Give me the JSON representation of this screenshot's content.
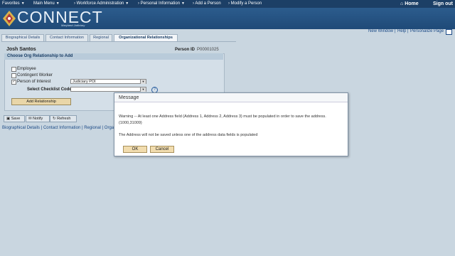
{
  "topnav": {
    "favorites": "Favorites",
    "main_menu": "Main Menu",
    "workforce": "Workforce Administration",
    "personal_info": "Personal Information",
    "add_person": "Add a Person",
    "modify_person": "Modify a Person",
    "home": "Home",
    "sign_out": "Sign out"
  },
  "banner": {
    "title": "CONNECT",
    "subtitle": "Maryland Judiciary"
  },
  "util": {
    "new_window": "New Window",
    "help": "Help",
    "personalize": "Personalize Page"
  },
  "tabs": [
    {
      "label": "Biographical Details"
    },
    {
      "label": "Contact Information"
    },
    {
      "label": "Regional"
    },
    {
      "label": "Organizational Relationships"
    }
  ],
  "person": {
    "name": "Josh Santos",
    "id_label": "Person ID",
    "id_value": "P00001025"
  },
  "section": {
    "title": "Choose Org Relationship to Add",
    "employee": "Employee",
    "contingent": "Contingent Worker",
    "poi": "Person of Interest",
    "poi_type": "Judiciary POI",
    "checklist_label": "Select Checklist Code",
    "checklist_value": "",
    "add_button": "Add Relationship"
  },
  "toolbar": {
    "save": "Save",
    "notify": "Notify",
    "refresh": "Refresh"
  },
  "bottom_links": {
    "bio": "Biographical Details",
    "contact": "Contact Information",
    "regional": "Regional",
    "org": "Organi"
  },
  "modal": {
    "title": "Message",
    "line1": "Warning -- At least one Address field (Address 1, Address 2, Address 3) must be populated in order to save the address.",
    "line2": "(1000,31009)",
    "line3": "The Address will not be saved unless one of the address data fields is populated",
    "ok": "OK",
    "cancel": "Cancel"
  },
  "colors": {
    "nav": "#1c3f66",
    "banner": "#2c5c8d",
    "page": "#c9d6e0",
    "button": "#e9d6a8"
  }
}
